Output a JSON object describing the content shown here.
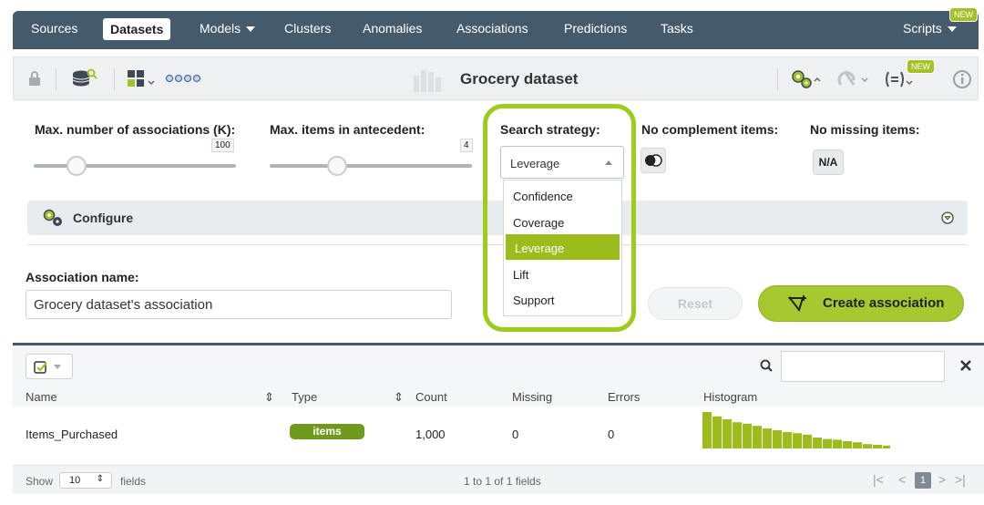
{
  "nav": {
    "items": [
      "Sources",
      "Datasets",
      "Models",
      "Clusters",
      "Anomalies",
      "Associations",
      "Predictions",
      "Tasks"
    ],
    "scripts": "Scripts",
    "new_badge": "NEW"
  },
  "toolbar": {
    "title": "Grocery dataset",
    "new_badge": "NEW",
    "icons": [
      "lock-icon",
      "database-search-icon",
      "dataset-ops-icon",
      "dots-icon",
      "gear-icon",
      "clone-icon",
      "formula-icon",
      "info-icon"
    ]
  },
  "params": {
    "max_assoc_label": "Max. number of associations (K):",
    "max_assoc_value": "100",
    "max_assoc_level": 0.1,
    "max_items_label": "Max. items in antecedent:",
    "max_items_value": "4",
    "max_items_level": 0.3,
    "strategy_label": "Search strategy:",
    "strategy_value": "Leverage",
    "strategy_options": [
      "Confidence",
      "Coverage",
      "Leverage",
      "Lift",
      "Support"
    ],
    "complement_label": "No complement items:",
    "missing_label": "No missing items:",
    "missing_btn": "N/A"
  },
  "configure": {
    "label": "Configure"
  },
  "association": {
    "name_label": "Association name:",
    "name_value": "Grocery dataset's association",
    "reset_label": "Reset",
    "create_label": "Create association"
  },
  "table": {
    "headers": [
      "Name",
      "Type",
      "Count",
      "Missing",
      "Errors",
      "Histogram"
    ],
    "rows": [
      {
        "name": "Items_Purchased",
        "type": "items",
        "count": "1,000",
        "missing": "0",
        "errors": "0"
      }
    ],
    "histogram": [
      1.0,
      0.88,
      0.8,
      0.72,
      0.68,
      0.62,
      0.55,
      0.5,
      0.45,
      0.42,
      0.38,
      0.3,
      0.26,
      0.24,
      0.2,
      0.17,
      0.12,
      0.1,
      0.08
    ],
    "show_label": "Show",
    "show_value": "10",
    "fields_label": "fields",
    "range_label": "1 to 1 of 1 fields",
    "page": "1"
  },
  "colors": {
    "nav_bg": "#455a6a",
    "accent": "#9cbc1c",
    "highlight": "#9ccc1c"
  }
}
